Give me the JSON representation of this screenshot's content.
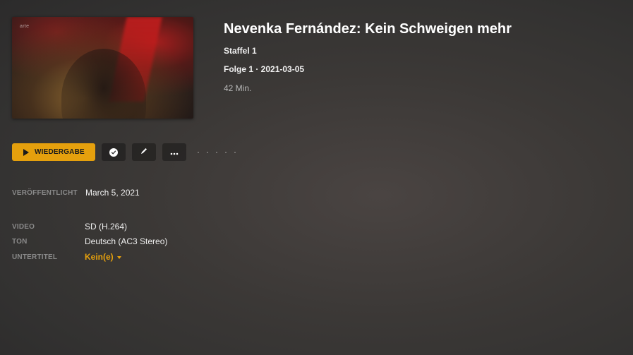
{
  "thumbnail": {
    "watermark": "arte",
    "alt": "episode-thumbnail"
  },
  "header": {
    "title": "Nevenka Fernández: Kein Schweigen mehr",
    "season": "Staffel 1",
    "episode": "Folge 1 · 2021-03-05",
    "duration": "42 Min."
  },
  "toolbar": {
    "play_label": "WIEDERGABE",
    "mark_watched_icon": "check-circle-icon",
    "edit_icon": "pencil-icon",
    "more_icon": "ellipsis-icon"
  },
  "details": {
    "released_label": "VERÖFFENTLICHT",
    "released_value": "March 5, 2021",
    "video_label": "VIDEO",
    "video_value": "SD (H.264)",
    "audio_label": "TON",
    "audio_value": "Deutsch (AC3 Stereo)",
    "subtitles_label": "UNTERTITEL",
    "subtitles_value": "Kein(e)"
  },
  "colors": {
    "accent": "#e5a00d",
    "background": "#3a3735",
    "label": "#8a8a8a"
  }
}
